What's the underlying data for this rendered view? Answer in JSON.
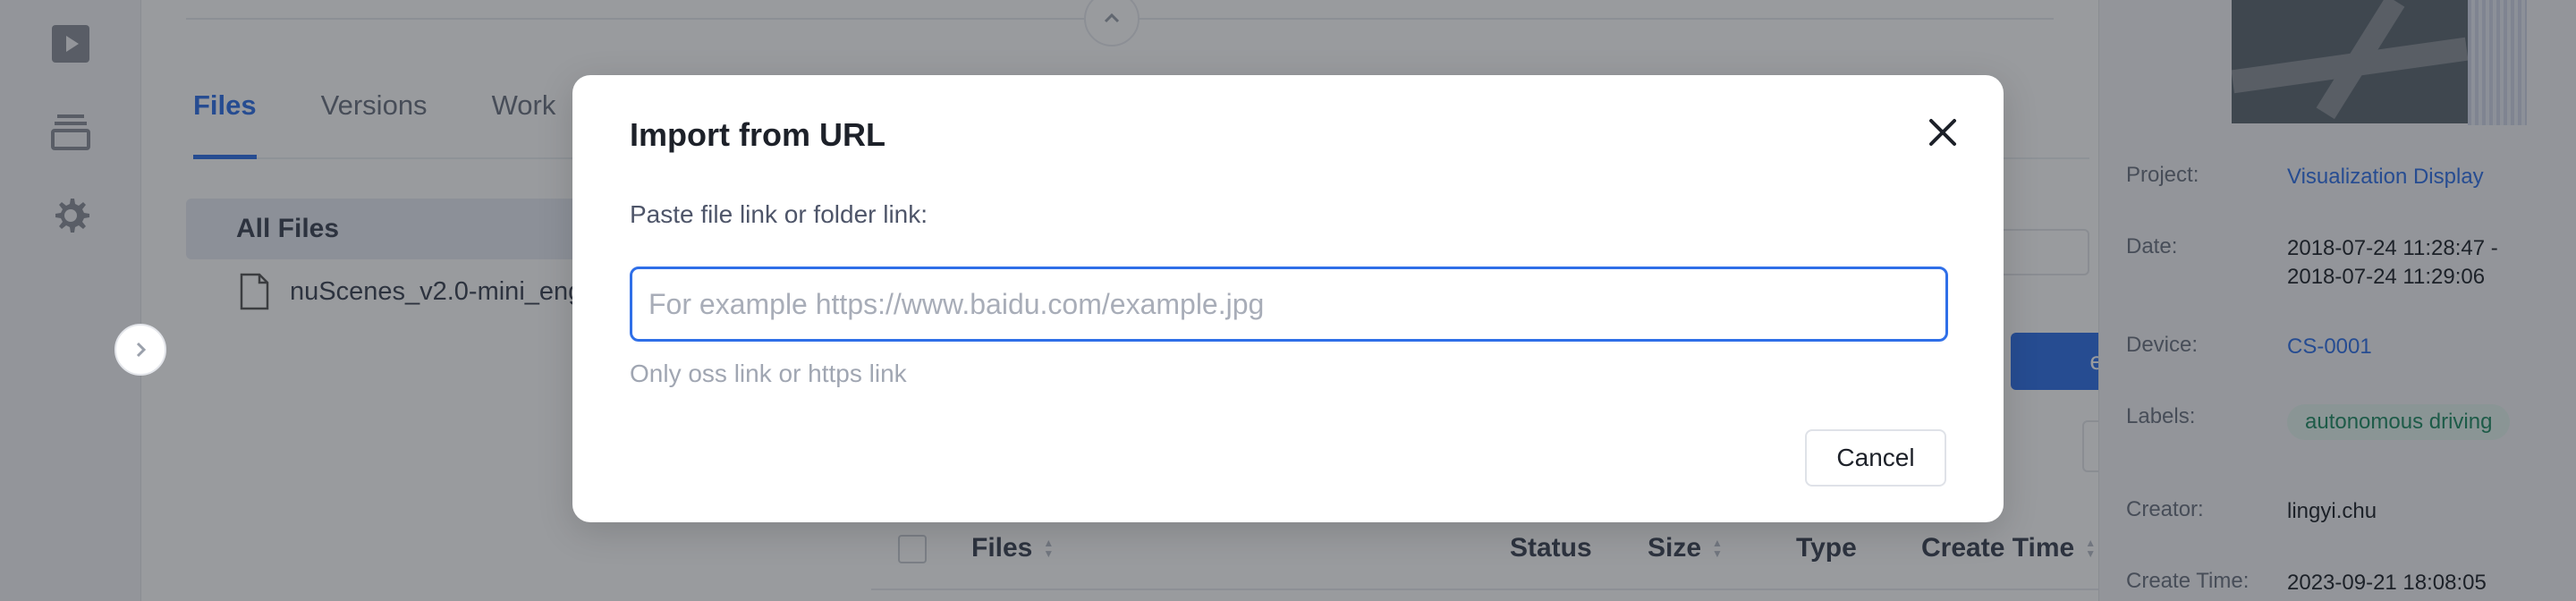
{
  "app": {
    "rail": {
      "icons": [
        "play-icon",
        "archive-icon",
        "gear-icon"
      ]
    },
    "tabs": [
      {
        "label": "Files",
        "active": true
      },
      {
        "label": "Versions",
        "active": false
      },
      {
        "label": "Work",
        "active": false
      }
    ],
    "tree": {
      "root_label": "All Files",
      "items": [
        {
          "label": "nuScenes_v2.0-mini_eng"
        }
      ]
    },
    "upload_label": "e",
    "table": {
      "columns": [
        "Files",
        "Status",
        "Size",
        "Type",
        "Create Time"
      ]
    }
  },
  "side_panel": {
    "project_label": "Project:",
    "project_value": "Visualization Display",
    "date_label": "Date:",
    "date_start": "2018-07-24 11:28:47 -",
    "date_end": "2018-07-24 11:29:06",
    "device_label": "Device:",
    "device_value": "CS-0001",
    "labels_label": "Labels:",
    "labels_value": "autonomous driving",
    "creator_label": "Creator:",
    "creator_value": "lingyi.chu",
    "create_time_label": "Create Time:",
    "create_time_value": "2023-09-21 18:08:05"
  },
  "modal": {
    "title": "Import from URL",
    "field_label": "Paste file link or folder link:",
    "input_value": "",
    "input_placeholder": "For example https://www.baidu.com/example.jpg",
    "hint": "Only oss link or https link",
    "cancel_label": "Cancel"
  },
  "colors": {
    "accent": "#2f6fe8",
    "overlay": "rgba(29,33,41,0.45)",
    "tag_bg": "#e4f4ee",
    "tag_text": "#1e8a63"
  }
}
